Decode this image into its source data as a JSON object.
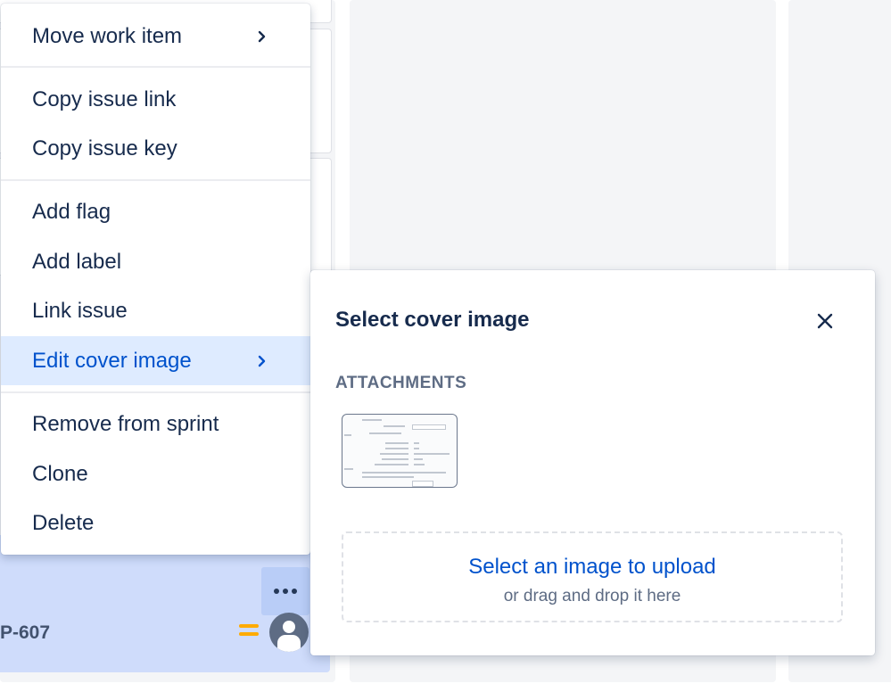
{
  "board": {
    "card": {
      "key": "P-607"
    }
  },
  "context_menu": {
    "items": [
      {
        "label": "Move work item",
        "has_submenu": true
      },
      {
        "label": "Copy issue link"
      },
      {
        "label": "Copy issue key"
      },
      {
        "label": "Add flag"
      },
      {
        "label": "Add label"
      },
      {
        "label": "Link issue"
      },
      {
        "label": "Edit cover image",
        "has_submenu": true,
        "active": true
      },
      {
        "label": "Remove from sprint"
      },
      {
        "label": "Clone"
      },
      {
        "label": "Delete"
      }
    ]
  },
  "cover_dialog": {
    "title": "Select cover image",
    "attachments_heading": "ATTACHMENTS",
    "upload_link": "Select an image to upload",
    "upload_hint": "or drag and drop it here"
  },
  "colors": {
    "accent": "#0052cc",
    "active_bg": "#deebff",
    "selected_card": "#cfdcfb",
    "priority": "#ffab00"
  }
}
